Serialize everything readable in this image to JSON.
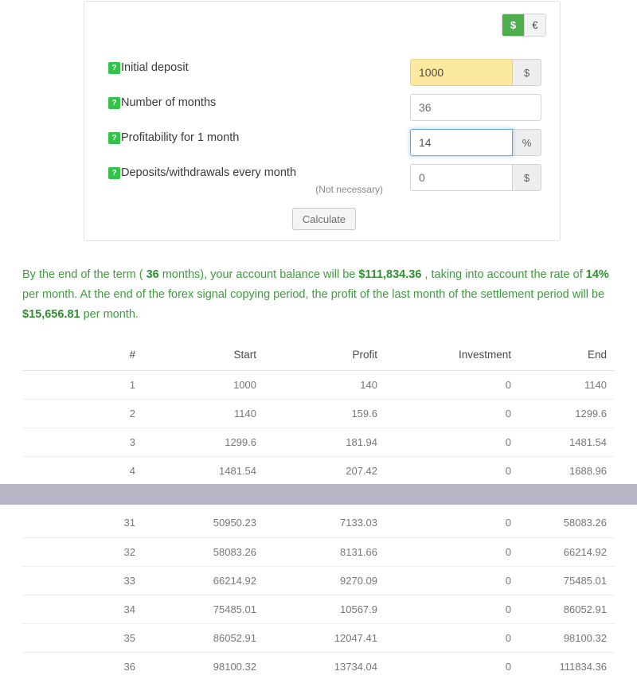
{
  "currency_toggle": {
    "options": [
      {
        "label": "$",
        "name": "dollar",
        "active": true
      },
      {
        "label": "€",
        "name": "euro",
        "active": false
      }
    ]
  },
  "form": {
    "help_badge": "?",
    "rows": [
      {
        "label": "Initial deposit",
        "sub_label": "",
        "value": "1000",
        "addon": "$",
        "state": "autofill"
      },
      {
        "label": "Number of months",
        "sub_label": "",
        "value": "36",
        "addon": "",
        "state": "normal"
      },
      {
        "label": "Profitability for 1 month",
        "sub_label": "",
        "value": "14",
        "addon": "%",
        "state": "focused"
      },
      {
        "label": "Deposits/withdrawals every month",
        "sub_label": "(Not necessary)",
        "value": "0",
        "addon": "$",
        "state": "normal"
      }
    ],
    "calculate_label": "Calculate"
  },
  "result": {
    "part_1": "By the end of the term ( ",
    "months": "36",
    "part_2": " months), your account balance will be ",
    "balance": "$111,834.36",
    "part_3": " , taking into account the rate of ",
    "rate": "14%",
    "part_4": " per month. At the end of the forex signal copying period, the profit of the last month of the settlement period will be ",
    "last_profit": "$15,656.81",
    "part_5": " per month."
  },
  "table": {
    "columns": [
      "#",
      "Start",
      "Profit",
      "Investment",
      "End"
    ],
    "rows_top": [
      [
        "1",
        "1000",
        "140",
        "0",
        "1140"
      ],
      [
        "2",
        "1140",
        "159.6",
        "0",
        "1299.6"
      ],
      [
        "3",
        "1299.6",
        "181.94",
        "0",
        "1481.54"
      ],
      [
        "4",
        "1481.54",
        "207.42",
        "0",
        "1688.96"
      ]
    ],
    "rows_bottom": [
      [
        "31",
        "50950.23",
        "7133.03",
        "0",
        "58083.26"
      ],
      [
        "32",
        "58083.26",
        "8131.66",
        "0",
        "66214.92"
      ],
      [
        "33",
        "66214.92",
        "9270.09",
        "0",
        "75485.01"
      ],
      [
        "34",
        "75485.01",
        "10567.9",
        "0",
        "86052.91"
      ],
      [
        "35",
        "86052.91",
        "12047.41",
        "0",
        "98100.32"
      ],
      [
        "36",
        "98100.32",
        "13734.04",
        "0",
        "111834.36"
      ]
    ]
  },
  "colors": {
    "accent_green": "#35c24a",
    "toggle_active": "#4cae4c",
    "result_green": "#3e9c3e",
    "autofill_yellow": "#fbe9a0",
    "focus_blue": "#62a8ea",
    "gap_band": "#b6b6c6"
  }
}
